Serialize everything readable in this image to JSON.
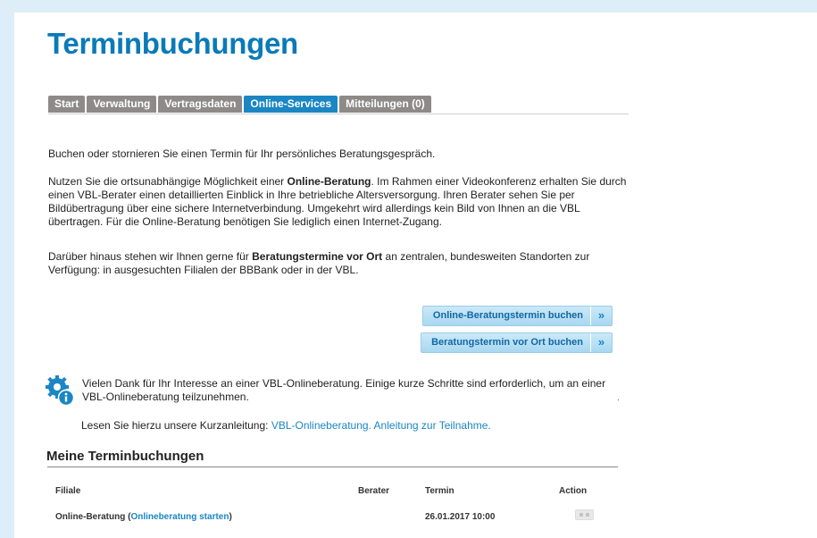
{
  "page": {
    "title": "Terminbuchungen"
  },
  "tabs": [
    {
      "label": "Start",
      "active": false
    },
    {
      "label": "Verwaltung",
      "active": false
    },
    {
      "label": "Vertragsdaten",
      "active": false
    },
    {
      "label": "Online-Services",
      "active": true
    },
    {
      "label": "Mitteilungen (0)",
      "active": false
    }
  ],
  "intro": {
    "p1": "Buchen oder stornieren Sie einen Termin für Ihr persönliches Beratungsgespräch.",
    "p2_pre": "Nutzen Sie die ortsunabhängige Möglichkeit einer ",
    "p2_bold": "Online-Beratung",
    "p2_post": ". Im Rahmen einer Videokonferenz erhalten Sie durch einen VBL-Berater einen detaillierten Einblick in Ihre betriebliche Altersversorgung. Ihren Berater sehen Sie per Bildübertragung über eine sichere Internetverbindung. Umgekehrt wird allerdings kein Bild von Ihnen an die VBL übertragen. Für die Online-Beratung benötigen Sie lediglich einen Internet-Zugang.",
    "p3_pre": "Darüber hinaus stehen wir Ihnen gerne für ",
    "p3_bold": "Beratungstermine vor Ort",
    "p3_post": " an zentralen, bundesweiten Standorten zur Verfügung: in ausgesuchten Filialen der BBBank oder in der VBL."
  },
  "buttons": {
    "online": "Online-Beratungstermin buchen",
    "onsite": "Beratungstermin vor Ort buchen",
    "arrow": "»"
  },
  "info": {
    "icon": "gear-info-icon",
    "text": "Vielen Dank für Ihr Interesse an einer VBL-Onlineberatung. Einige kurze Schritte sind erforderlich, um an einer VBL-Onlineberatung teilzunehmen.",
    "guide_pre": "Lesen Sie hierzu unsere Kurzanleitung: ",
    "guide_link": "VBL-Onlineberatung. Anleitung zur Teilnahme."
  },
  "bookings": {
    "title": "Meine Terminbuchungen",
    "columns": [
      "Filiale",
      "Berater",
      "Termin",
      "Action"
    ],
    "rows": [
      {
        "filiale_pre": "Online-Beratung (",
        "filiale_link": "Onlineberatung starten",
        "filiale_post": ")",
        "berater": "",
        "termin": "26.01.2017 10:00",
        "action_icon": "toggle-icon"
      }
    ]
  },
  "colors": {
    "accent": "#1b86c4",
    "title": "#0a7ab8",
    "tab_inactive": "#8d8a87",
    "frame": "#ddeef8"
  }
}
